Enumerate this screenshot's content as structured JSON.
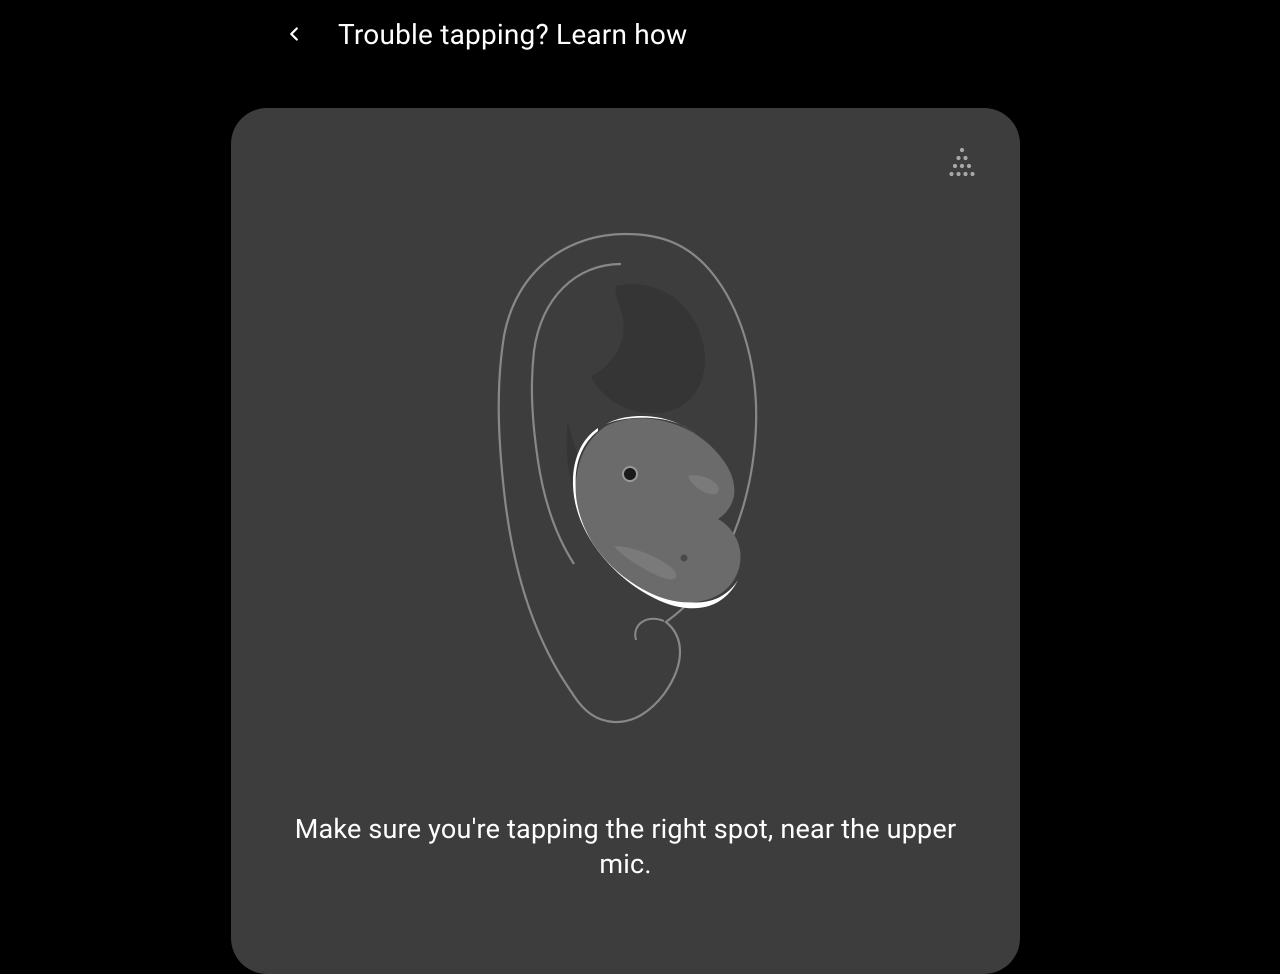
{
  "header": {
    "title": "Trouble tapping? Learn how"
  },
  "card": {
    "instruction": "Make sure you're tapping the right spot, near the upper mic."
  }
}
